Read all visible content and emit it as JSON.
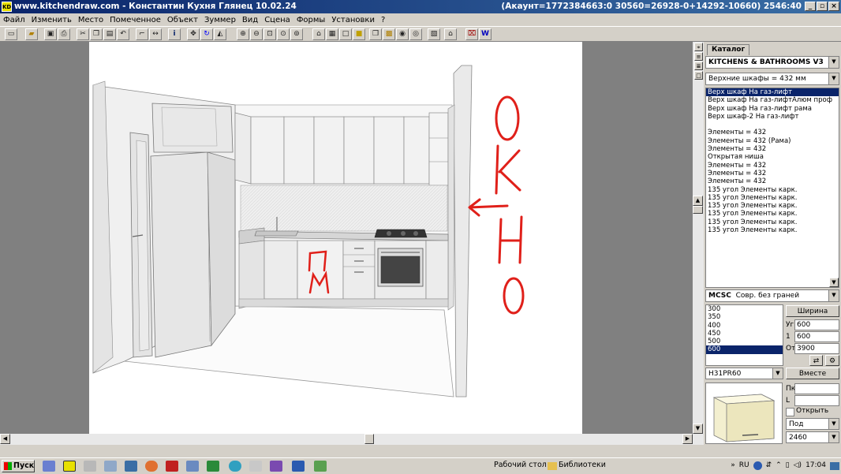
{
  "window": {
    "title": "www.kitchendraw.com - Константин Кухня Глянец 10.02.24",
    "account_info": "(Акаунт=1772384663:0 30560=26928-0+14292-10660) 2546:40",
    "app_icon": "KD"
  },
  "menu": [
    "Файл",
    "Изменить",
    "Место",
    "Помеченное",
    "Объект",
    "Зуммер",
    "Вид",
    "Сцена",
    "Формы",
    "Установки",
    "?"
  ],
  "toolbar_icons": [
    "new-icon",
    "open-icon",
    "save-icon",
    "print-icon",
    "cut-icon",
    "copy-icon",
    "paste-icon",
    "undo-icon",
    "dimension-icon",
    "measure-icon",
    "info-icon",
    "move-icon",
    "rotate-icon",
    "mirror-icon",
    "zoom-in-icon",
    "zoom-out-icon",
    "zoom-window-icon",
    "zoom-prev-icon",
    "zoom-all-icon",
    "plan-view-icon",
    "front-view-icon",
    "render-icon",
    "box-icon",
    "3d-box-icon",
    "solid-icon",
    "camera-icon",
    "photo-icon",
    "gallery-icon",
    "house-icon",
    "door-icon",
    "word-icon"
  ],
  "annotation": {
    "okno": [
      "О",
      "К",
      "Н",
      "О"
    ],
    "pm": [
      "П",
      "М"
    ],
    "color": "#e0201a"
  },
  "catalog": {
    "tab_label": "Каталог",
    "name": "KITCHENS & BATHROOMS V3",
    "category": "Верхние шкафы = 432 мм",
    "items": [
      "Верх шкаф На газ-лифт",
      "Верх шкаф На газ-лифтАлюм проф",
      "Верх шкаф На газ-лифт рама",
      "Верх шкаф-2 На газ-лифт",
      "",
      "Элементы = 432",
      "Элементы = 432 (Рама)",
      "Элементы = 432",
      "Открытая ниша",
      "Элементы = 432",
      "Элементы = 432",
      "Элементы = 432",
      "135 угол Элементы карк.",
      "135 угол Элементы карк.",
      "135 угол Элементы карк.",
      "135 угол Элементы карк.",
      "135 угол Элементы карк.",
      "135 угол Элементы карк."
    ],
    "selected_index": 0
  },
  "finish": {
    "code": "MCSC",
    "name": "Совр. без граней"
  },
  "widths": {
    "options": [
      "300",
      "350",
      "400",
      "450",
      "500",
      "600"
    ],
    "selected_index": 5
  },
  "width_button": "Ширина",
  "params": [
    {
      "label": "Уг",
      "value": "600"
    },
    {
      "label": "1",
      "value": "600"
    },
    {
      "label": "От",
      "value": "3900"
    }
  ],
  "model_code": "H31PR60",
  "insert_button": "Вместе",
  "placement": {
    "pk_label": "Пк",
    "pk_value": "",
    "l_label": "L",
    "l_value": "",
    "open_label": "Открыть",
    "position_value": "Под",
    "height_value": "2460"
  },
  "taskbar": {
    "start_label": "Пуск",
    "desktop_label": "Рабочий стол",
    "library_label": "Библиотеки",
    "lang": "RU",
    "time": "17:04"
  }
}
